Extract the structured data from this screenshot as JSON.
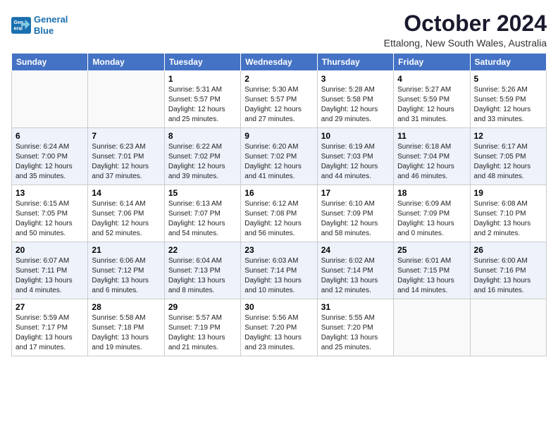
{
  "logo": {
    "line1": "General",
    "line2": "Blue"
  },
  "title": "October 2024",
  "subtitle": "Ettalong, New South Wales, Australia",
  "days_of_week": [
    "Sunday",
    "Monday",
    "Tuesday",
    "Wednesday",
    "Thursday",
    "Friday",
    "Saturday"
  ],
  "weeks": [
    [
      {
        "day": "",
        "info": ""
      },
      {
        "day": "",
        "info": ""
      },
      {
        "day": "1",
        "info": "Sunrise: 5:31 AM\nSunset: 5:57 PM\nDaylight: 12 hours\nand 25 minutes."
      },
      {
        "day": "2",
        "info": "Sunrise: 5:30 AM\nSunset: 5:57 PM\nDaylight: 12 hours\nand 27 minutes."
      },
      {
        "day": "3",
        "info": "Sunrise: 5:28 AM\nSunset: 5:58 PM\nDaylight: 12 hours\nand 29 minutes."
      },
      {
        "day": "4",
        "info": "Sunrise: 5:27 AM\nSunset: 5:59 PM\nDaylight: 12 hours\nand 31 minutes."
      },
      {
        "day": "5",
        "info": "Sunrise: 5:26 AM\nSunset: 5:59 PM\nDaylight: 12 hours\nand 33 minutes."
      }
    ],
    [
      {
        "day": "6",
        "info": "Sunrise: 6:24 AM\nSunset: 7:00 PM\nDaylight: 12 hours\nand 35 minutes."
      },
      {
        "day": "7",
        "info": "Sunrise: 6:23 AM\nSunset: 7:01 PM\nDaylight: 12 hours\nand 37 minutes."
      },
      {
        "day": "8",
        "info": "Sunrise: 6:22 AM\nSunset: 7:02 PM\nDaylight: 12 hours\nand 39 minutes."
      },
      {
        "day": "9",
        "info": "Sunrise: 6:20 AM\nSunset: 7:02 PM\nDaylight: 12 hours\nand 41 minutes."
      },
      {
        "day": "10",
        "info": "Sunrise: 6:19 AM\nSunset: 7:03 PM\nDaylight: 12 hours\nand 44 minutes."
      },
      {
        "day": "11",
        "info": "Sunrise: 6:18 AM\nSunset: 7:04 PM\nDaylight: 12 hours\nand 46 minutes."
      },
      {
        "day": "12",
        "info": "Sunrise: 6:17 AM\nSunset: 7:05 PM\nDaylight: 12 hours\nand 48 minutes."
      }
    ],
    [
      {
        "day": "13",
        "info": "Sunrise: 6:15 AM\nSunset: 7:05 PM\nDaylight: 12 hours\nand 50 minutes."
      },
      {
        "day": "14",
        "info": "Sunrise: 6:14 AM\nSunset: 7:06 PM\nDaylight: 12 hours\nand 52 minutes."
      },
      {
        "day": "15",
        "info": "Sunrise: 6:13 AM\nSunset: 7:07 PM\nDaylight: 12 hours\nand 54 minutes."
      },
      {
        "day": "16",
        "info": "Sunrise: 6:12 AM\nSunset: 7:08 PM\nDaylight: 12 hours\nand 56 minutes."
      },
      {
        "day": "17",
        "info": "Sunrise: 6:10 AM\nSunset: 7:09 PM\nDaylight: 12 hours\nand 58 minutes."
      },
      {
        "day": "18",
        "info": "Sunrise: 6:09 AM\nSunset: 7:09 PM\nDaylight: 13 hours\nand 0 minutes."
      },
      {
        "day": "19",
        "info": "Sunrise: 6:08 AM\nSunset: 7:10 PM\nDaylight: 13 hours\nand 2 minutes."
      }
    ],
    [
      {
        "day": "20",
        "info": "Sunrise: 6:07 AM\nSunset: 7:11 PM\nDaylight: 13 hours\nand 4 minutes."
      },
      {
        "day": "21",
        "info": "Sunrise: 6:06 AM\nSunset: 7:12 PM\nDaylight: 13 hours\nand 6 minutes."
      },
      {
        "day": "22",
        "info": "Sunrise: 6:04 AM\nSunset: 7:13 PM\nDaylight: 13 hours\nand 8 minutes."
      },
      {
        "day": "23",
        "info": "Sunrise: 6:03 AM\nSunset: 7:14 PM\nDaylight: 13 hours\nand 10 minutes."
      },
      {
        "day": "24",
        "info": "Sunrise: 6:02 AM\nSunset: 7:14 PM\nDaylight: 13 hours\nand 12 minutes."
      },
      {
        "day": "25",
        "info": "Sunrise: 6:01 AM\nSunset: 7:15 PM\nDaylight: 13 hours\nand 14 minutes."
      },
      {
        "day": "26",
        "info": "Sunrise: 6:00 AM\nSunset: 7:16 PM\nDaylight: 13 hours\nand 16 minutes."
      }
    ],
    [
      {
        "day": "27",
        "info": "Sunrise: 5:59 AM\nSunset: 7:17 PM\nDaylight: 13 hours\nand 17 minutes."
      },
      {
        "day": "28",
        "info": "Sunrise: 5:58 AM\nSunset: 7:18 PM\nDaylight: 13 hours\nand 19 minutes."
      },
      {
        "day": "29",
        "info": "Sunrise: 5:57 AM\nSunset: 7:19 PM\nDaylight: 13 hours\nand 21 minutes."
      },
      {
        "day": "30",
        "info": "Sunrise: 5:56 AM\nSunset: 7:20 PM\nDaylight: 13 hours\nand 23 minutes."
      },
      {
        "day": "31",
        "info": "Sunrise: 5:55 AM\nSunset: 7:20 PM\nDaylight: 13 hours\nand 25 minutes."
      },
      {
        "day": "",
        "info": ""
      },
      {
        "day": "",
        "info": ""
      }
    ]
  ]
}
